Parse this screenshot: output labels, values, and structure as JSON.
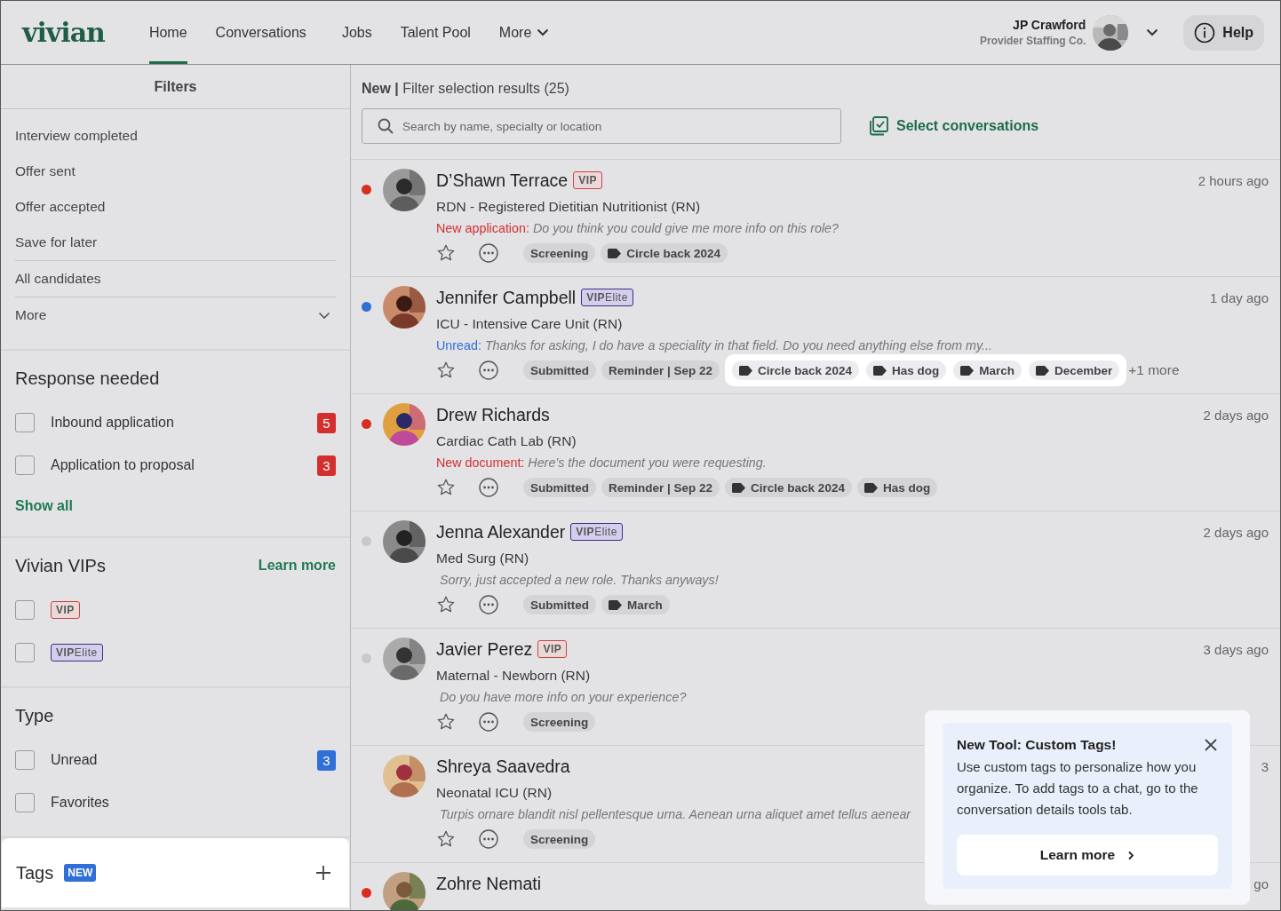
{
  "header": {
    "logo": "vivian",
    "nav": [
      {
        "label": "Home",
        "selected": true,
        "kind": "link"
      },
      {
        "label": "Conversations",
        "selected": false,
        "kind": "link"
      },
      {
        "label": "Jobs",
        "selected": false,
        "kind": "link"
      },
      {
        "label": "Talent Pool",
        "selected": false,
        "kind": "link"
      },
      {
        "label": "More",
        "selected": false,
        "kind": "menu"
      }
    ],
    "user": {
      "name": "JP Crawford",
      "company": "Provider Staffing Co."
    },
    "help": "Help"
  },
  "sidebar": {
    "title": "Filters",
    "stage_groups": [
      [
        "Interview completed",
        "Offer sent",
        "Offer accepted",
        "Save for later"
      ],
      [
        "All candidates"
      ]
    ],
    "more": {
      "label": "More",
      "expanded": false
    },
    "sections": [
      {
        "title": "Response needed",
        "items": [
          {
            "label": "Inbound application",
            "checked": false,
            "count": "5",
            "color": "#d32f2f"
          },
          {
            "label": "Application to proposal",
            "checked": false,
            "count": "3",
            "color": "#d32f2f"
          }
        ],
        "footer_link": "Show all"
      },
      {
        "title": "Vivian VIPs",
        "header_link": "Learn more",
        "items": [
          {
            "badge": {
              "kind": "vip",
              "text": "VIP"
            },
            "checked": false
          },
          {
            "badge": {
              "kind": "vip_elite",
              "text": "**VIP**Elite"
            },
            "checked": false
          }
        ]
      },
      {
        "title": "Type",
        "items": [
          {
            "label": "Unread",
            "checked": false,
            "count": "3",
            "color": "#2f6fd6"
          },
          {
            "label": "Favorites",
            "checked": false
          }
        ]
      }
    ],
    "tags": {
      "title": "Tags",
      "badge": "NEW",
      "highlighted": true
    }
  },
  "main": {
    "heading": "**New |** Filter selection results (25)",
    "search": {
      "placeholder": "Search by name, specialty or location"
    },
    "select_button": "Select conversations",
    "rows": [
      {
        "color": "#d92d20",
        "name": "D’Shawn Terrace",
        "badge": {
          "kind": "vip",
          "text": "VIP"
        },
        "time": "2 hours ago",
        "subtitle": "RDN - Registered Dietitian Nutritionist (RN)",
        "status": {
          "kind": "new",
          "text": "New application:"
        },
        "message": "Do you think you could give me more info on this role?",
        "starred": false,
        "tags": [
          {
            "kind": "status",
            "text": "Screening"
          },
          {
            "kind": "custom",
            "text": "Circle back 2024"
          }
        ]
      },
      {
        "color": "#2f6fd6",
        "name": "Jennifer Campbell",
        "badge": {
          "kind": "vip_elite",
          "text": "**VIP**Elite"
        },
        "time": "1 day ago",
        "subtitle": "ICU - Intensive Care Unit (RN)",
        "status": {
          "kind": "unread",
          "text": "Unread:"
        },
        "message": "Thanks for asking, I do have a speciality in that field. Do you need anything else from my...",
        "starred": false,
        "tags": [
          {
            "kind": "status",
            "text": "Submitted"
          },
          {
            "kind": "status",
            "text": "Reminder | Sep 22"
          }
        ],
        "spotlight_tags": [
          {
            "kind": "custom",
            "text": "Circle back 2024"
          },
          {
            "kind": "custom",
            "text": "Has dog"
          },
          {
            "kind": "custom",
            "text": "March"
          },
          {
            "kind": "custom",
            "text": "December"
          }
        ],
        "more_tags": "+1 more"
      },
      {
        "color": "#d92d20",
        "name": "Drew Richards",
        "time": "2 days ago",
        "subtitle": "Cardiac Cath Lab (RN)",
        "status": {
          "kind": "new",
          "text": "New document:"
        },
        "message": "Here’s the document you were requesting.",
        "starred": false,
        "tags": [
          {
            "kind": "status",
            "text": "Submitted"
          },
          {
            "kind": "status",
            "text": "Reminder | Sep 22"
          },
          {
            "kind": "custom",
            "text": "Circle back 2024"
          },
          {
            "kind": "custom",
            "text": "Has dog"
          }
        ]
      },
      {
        "color": "#c8c8cc",
        "name": "Jenna Alexander",
        "badge": {
          "kind": "vip_elite",
          "text": "**VIP**Elite"
        },
        "time": "2 days ago",
        "subtitle": "Med Surg (RN)",
        "message": "Sorry, just accepted a new role. Thanks anyways!",
        "starred": false,
        "tags": [
          {
            "kind": "status",
            "text": "Submitted"
          },
          {
            "kind": "custom",
            "text": "March"
          }
        ]
      },
      {
        "color": "#c8c8cc",
        "name": "Javier Perez",
        "badge": {
          "kind": "vip",
          "text": "VIP"
        },
        "time": "3 days ago",
        "subtitle": "Maternal - Newborn (RN)",
        "message": "Do you have more info on your experience?",
        "starred": false,
        "tags": [
          {
            "kind": "status",
            "text": "Screening"
          }
        ]
      },
      {
        "name": "Shreya Saavedra",
        "time": "3",
        "subtitle": "Neonatal ICU (RN)",
        "message": "Turpis ornare blandit nisl pellentesque urna. Aenean urna aliquet amet tellus aenear",
        "starred": false,
        "tags": [
          {
            "kind": "status",
            "text": "Screening"
          }
        ]
      },
      {
        "color": "#d92d20",
        "name": "Zohre Nemati",
        "time": "go"
      }
    ]
  },
  "popover": {
    "title": "New Tool: Custom Tags!",
    "body": "Use custom tags to personalize how you organize. To add tags to a chat, go to the conversation details tools tab.",
    "button": "Learn more"
  }
}
